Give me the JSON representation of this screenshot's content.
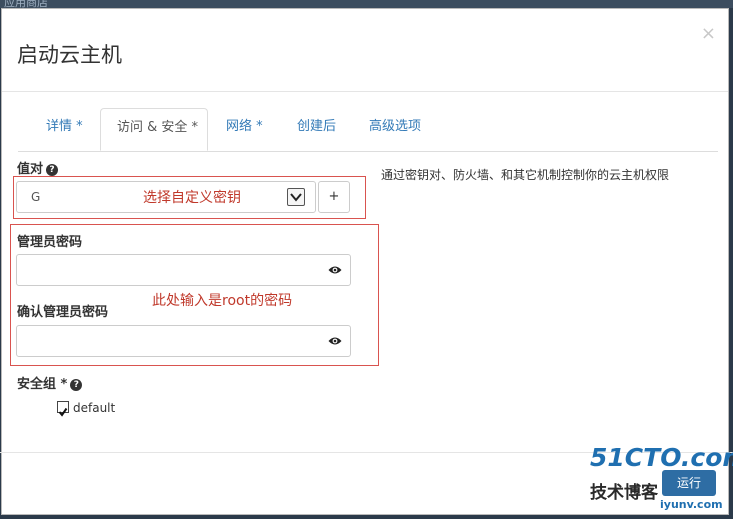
{
  "background_app": {
    "text": "应用商店"
  },
  "dialog": {
    "title": "启动云主机",
    "close_icon": "×"
  },
  "tabs": [
    {
      "label": "详情 *"
    },
    {
      "label": "访问 & 安全 *",
      "active": true
    },
    {
      "label": "网络 *"
    },
    {
      "label": "创建后"
    },
    {
      "label": "高级选项"
    }
  ],
  "keypair": {
    "label": "值对",
    "value": "G",
    "add_label": "+"
  },
  "help_text": "通过密钥对、防火墙、和其它机制控制你的云主机权限",
  "annotations": {
    "keypair_note": "选择自定义密钥",
    "password_note": "此处输入是root的密码"
  },
  "admin_password": {
    "label": "管理员密码",
    "value": ""
  },
  "confirm_password": {
    "label": "确认管理员密码",
    "value": ""
  },
  "security_groups": {
    "label": "安全组 *",
    "items": [
      {
        "label": "default",
        "checked": true
      }
    ]
  },
  "watermark": {
    "line1": "51CTO.com",
    "line2": "技术博客",
    "line3": "iyunv.com"
  },
  "footer": {
    "launch_label": "运行"
  },
  "colors": {
    "accent": "#337ab7",
    "annotation": "#c0392b",
    "button": "#2e6da4"
  }
}
